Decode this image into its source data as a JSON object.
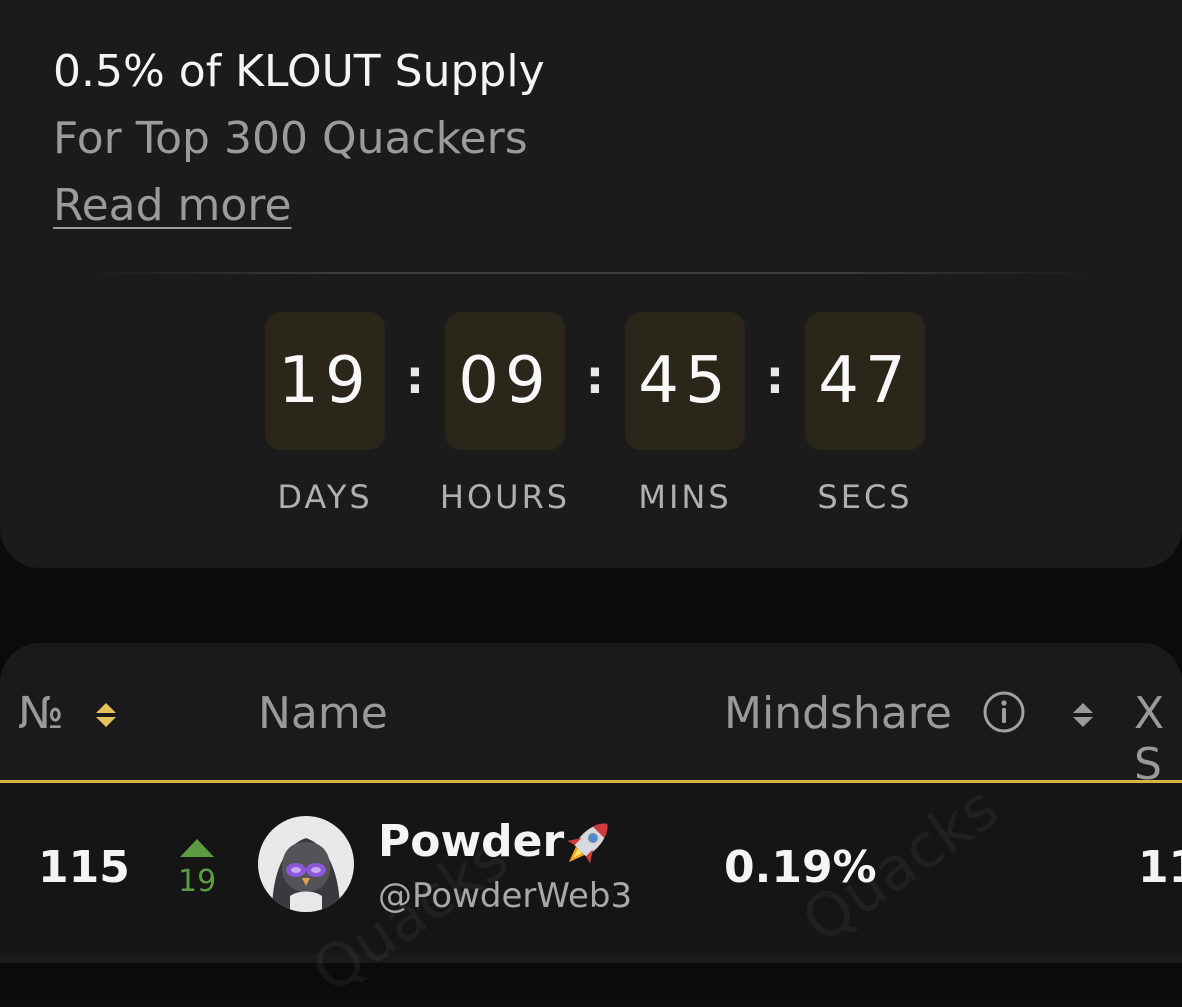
{
  "promo": {
    "title": "0.5% of KLOUT Supply",
    "subtitle": "For Top 300 Quackers",
    "read_more": "Read more"
  },
  "countdown": {
    "days": "19",
    "hours": "09",
    "mins": "45",
    "secs": "47",
    "separator": ":",
    "labels": {
      "days": "DAYS",
      "hours": "HOURS",
      "mins": "MINS",
      "secs": "SECS"
    }
  },
  "table": {
    "columns": {
      "rank": "№",
      "name": "Name",
      "mindshare": "Mindshare",
      "x": "X S"
    },
    "rows": [
      {
        "rank": "115",
        "change": "19",
        "change_direction": "up",
        "name": "Powder",
        "name_emoji": "rocket-icon",
        "handle": "@PowderWeb3",
        "mindshare": "0.19%",
        "x": "11"
      }
    ],
    "watermark": "Quacks"
  },
  "colors": {
    "accent": "#d8b34a",
    "positive": "#5d9b43",
    "card_bg": "#1b1b1b",
    "countdown_box": "#2a2619"
  }
}
